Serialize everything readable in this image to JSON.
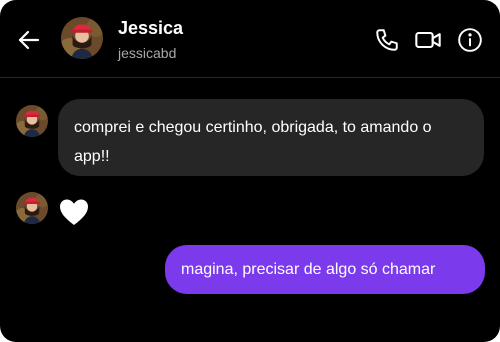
{
  "header": {
    "back_icon": "arrow-left-icon",
    "name": "Jessica",
    "username": "jessicabd",
    "actions": [
      {
        "icon": "phone-icon"
      },
      {
        "icon": "video-camera-icon"
      },
      {
        "icon": "info-icon"
      }
    ]
  },
  "messages": [
    {
      "from": "contact",
      "text": "comprei e chegou certinho, obrigada, to amando o app!!"
    },
    {
      "from": "contact",
      "reaction": "white-heart-emoji"
    },
    {
      "from": "me",
      "text": "magina, precisar de algo só chamar"
    }
  ],
  "colors": {
    "background": "#000000",
    "incoming_bubble": "#262626",
    "outgoing_bubble": "#7c3aed",
    "text": "#ffffff",
    "secondary_text": "#a8a8a8"
  }
}
